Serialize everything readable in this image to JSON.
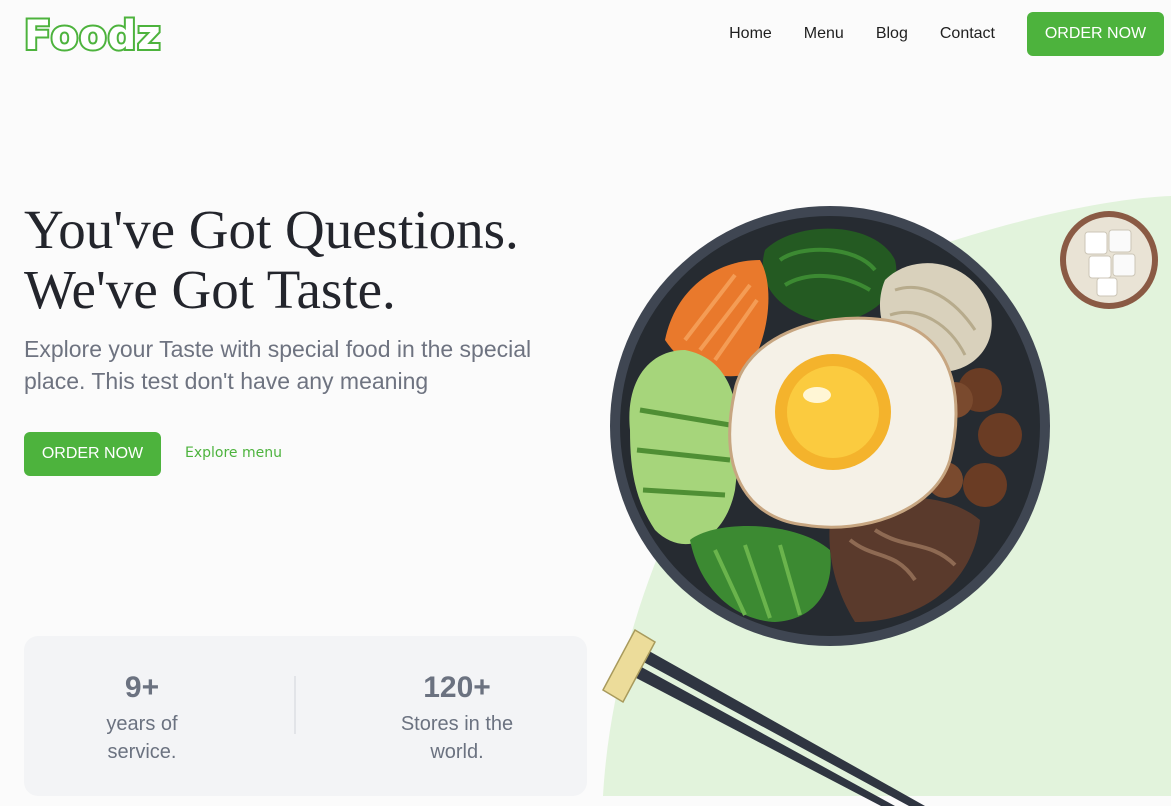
{
  "brand": {
    "name": "Foodz",
    "accent_color": "#4db33d"
  },
  "nav": {
    "items": [
      {
        "label": "Home"
      },
      {
        "label": "Menu"
      },
      {
        "label": "Blog"
      },
      {
        "label": "Contact"
      }
    ],
    "cta_label": "ORDER NOW"
  },
  "hero": {
    "title_line_1": "You've Got Questions.",
    "title_line_2": "We've Got Taste.",
    "subtitle": "Explore your Taste with special food in the special place. This test don't have any meaning",
    "primary_button": "ORDER NOW",
    "secondary_link": "Explore menu"
  },
  "stats": [
    {
      "value": "9+",
      "label_line_1": "years of",
      "label_line_2": "service."
    },
    {
      "value": "120+",
      "label_line_1": "Stores in the",
      "label_line_2": "world."
    }
  ],
  "illustration": {
    "bowl": "bibimbap-bowl-illustration",
    "side_dish": "tofu-side-dish-illustration",
    "utensil": "chopsticks-illustration",
    "background_color": "#e2f3dc"
  }
}
